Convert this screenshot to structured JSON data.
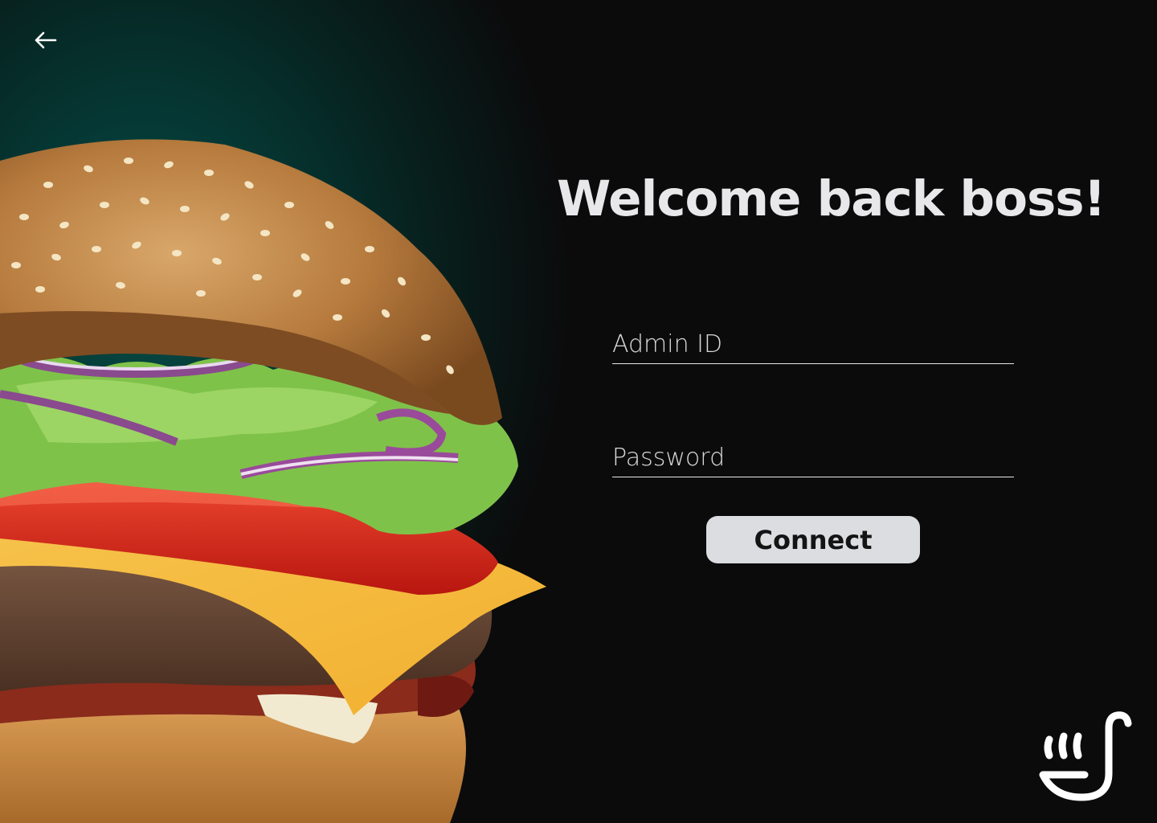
{
  "nav": {
    "back_icon": "arrow-left-icon"
  },
  "main": {
    "title": "Welcome back boss!"
  },
  "form": {
    "admin_id_placeholder": "Admin ID",
    "admin_id_value": "",
    "password_placeholder": "Password",
    "password_value": "",
    "connect_label": "Connect"
  },
  "branding": {
    "logo_icon": "ladle-steam-logo-icon"
  },
  "image": {
    "subject": "burger-photo"
  },
  "colors": {
    "background": "#0b0b0c",
    "glow": "#064a44",
    "text": "#e8e8ea",
    "button_bg": "#dcdde1",
    "button_text": "#141414"
  }
}
